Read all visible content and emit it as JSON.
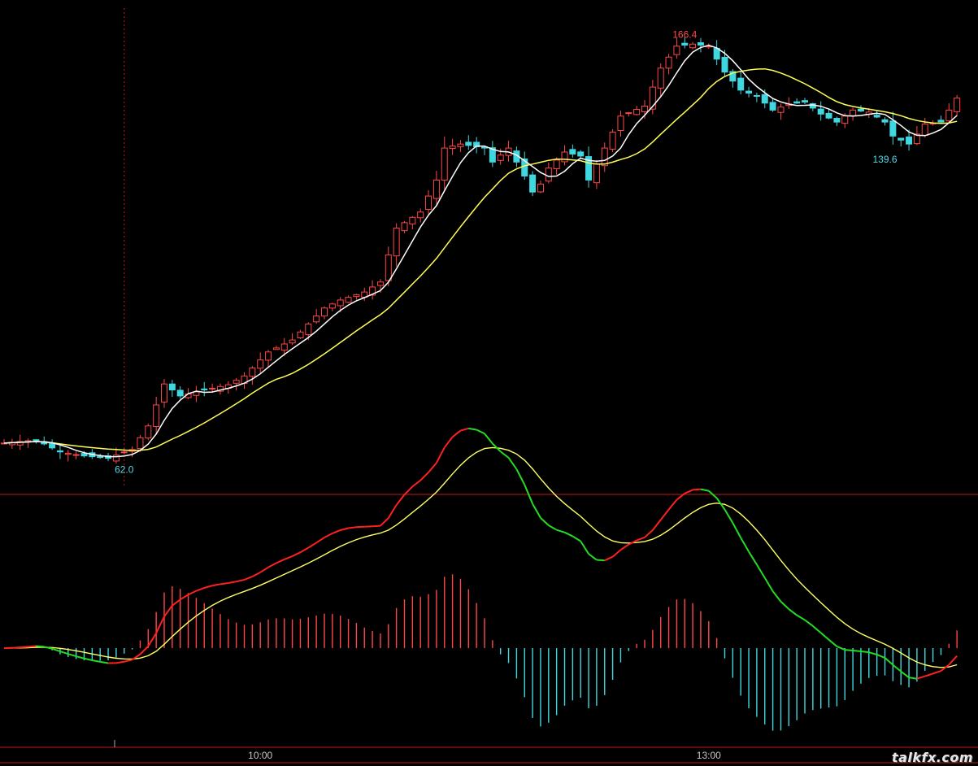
{
  "chart_data": [
    {
      "type": "candlestick",
      "title": "",
      "ylim": [
        55,
        175
      ],
      "series": [
        {
          "name": "",
          "kind": "ohlc",
          "bars": 120
        },
        {
          "name": "",
          "kind": "ma_short",
          "color": "#ffffff"
        },
        {
          "name": "",
          "kind": "ma_long",
          "color": "#ffff55"
        }
      ],
      "close_anchors": [
        [
          0,
          66.2
        ],
        [
          4,
          67.0
        ],
        [
          7,
          64.0
        ],
        [
          10,
          63.0
        ],
        [
          13,
          62.4
        ],
        [
          15,
          64.0
        ],
        [
          16,
          64.6
        ],
        [
          18,
          70.5
        ],
        [
          20,
          81.0
        ],
        [
          22,
          78.0
        ],
        [
          25,
          79.5
        ],
        [
          28,
          80.8
        ],
        [
          30,
          83.0
        ],
        [
          33,
          89.0
        ],
        [
          36,
          92.0
        ],
        [
          38,
          96.0
        ],
        [
          40,
          100.0
        ],
        [
          42,
          102.0
        ],
        [
          45,
          104.0
        ],
        [
          47,
          106.5
        ],
        [
          49,
          120.0
        ],
        [
          52,
          124.0
        ],
        [
          54,
          132.0
        ],
        [
          55,
          140.0
        ],
        [
          57,
          141.0
        ],
        [
          60,
          140.0
        ],
        [
          61,
          136.5
        ],
        [
          63,
          140.0
        ],
        [
          65,
          133.0
        ],
        [
          66,
          129.0
        ],
        [
          67,
          131.0
        ],
        [
          68,
          135.0
        ],
        [
          70,
          139.0
        ],
        [
          72,
          138.0
        ],
        [
          73,
          132.0
        ],
        [
          75,
          140.0
        ],
        [
          77,
          148.0
        ],
        [
          80,
          150.5
        ],
        [
          82,
          160.0
        ],
        [
          84,
          165.5
        ],
        [
          86,
          166.0
        ],
        [
          88,
          165.5
        ],
        [
          90,
          159.0
        ],
        [
          92,
          154.5
        ],
        [
          94,
          153.0
        ],
        [
          96,
          149.5
        ],
        [
          98,
          151.0
        ],
        [
          100,
          151.5
        ],
        [
          102,
          148.5
        ],
        [
          104,
          146.5
        ],
        [
          106,
          149.5
        ],
        [
          108,
          149.0
        ],
        [
          110,
          146.5
        ],
        [
          111,
          143.0
        ],
        [
          113,
          141.0
        ],
        [
          115,
          146.0
        ],
        [
          117,
          146.5
        ],
        [
          118,
          149.5
        ],
        [
          119,
          152.5
        ]
      ],
      "annotations": [
        {
          "text": "166.4",
          "value": 166.4,
          "bar": 85,
          "color": "#ff4a4a"
        },
        {
          "text": "139.6",
          "value": 139.6,
          "bar": 110,
          "color": "#55d8e6"
        },
        {
          "text": "62.0",
          "value": 62.0,
          "bar": 15,
          "color": "#55d8e6"
        }
      ],
      "marker_bar": 15,
      "colors": {
        "up": "#ff4646",
        "down": "#3fd7e0",
        "ma_short": "#ffffff",
        "ma_long": "#ffff55"
      }
    },
    {
      "type": "macd",
      "title": "",
      "ylim": [
        -6,
        9
      ],
      "series": [
        {
          "name": "",
          "kind": "dif",
          "color_up": "#ff2020",
          "color_down": "#22dd22"
        },
        {
          "name": "",
          "kind": "dea",
          "color": "#ffff66"
        },
        {
          "name": "",
          "kind": "histogram",
          "color_up": "#ff4646",
          "color_down": "#3fd7e0"
        }
      ],
      "zero": 0,
      "source": "derived from price series of chart 1"
    }
  ],
  "time_axis": {
    "ticks": [
      "10:00",
      "13:00"
    ],
    "tick_bars": [
      32,
      88
    ]
  },
  "watermark": "talkfx.com"
}
